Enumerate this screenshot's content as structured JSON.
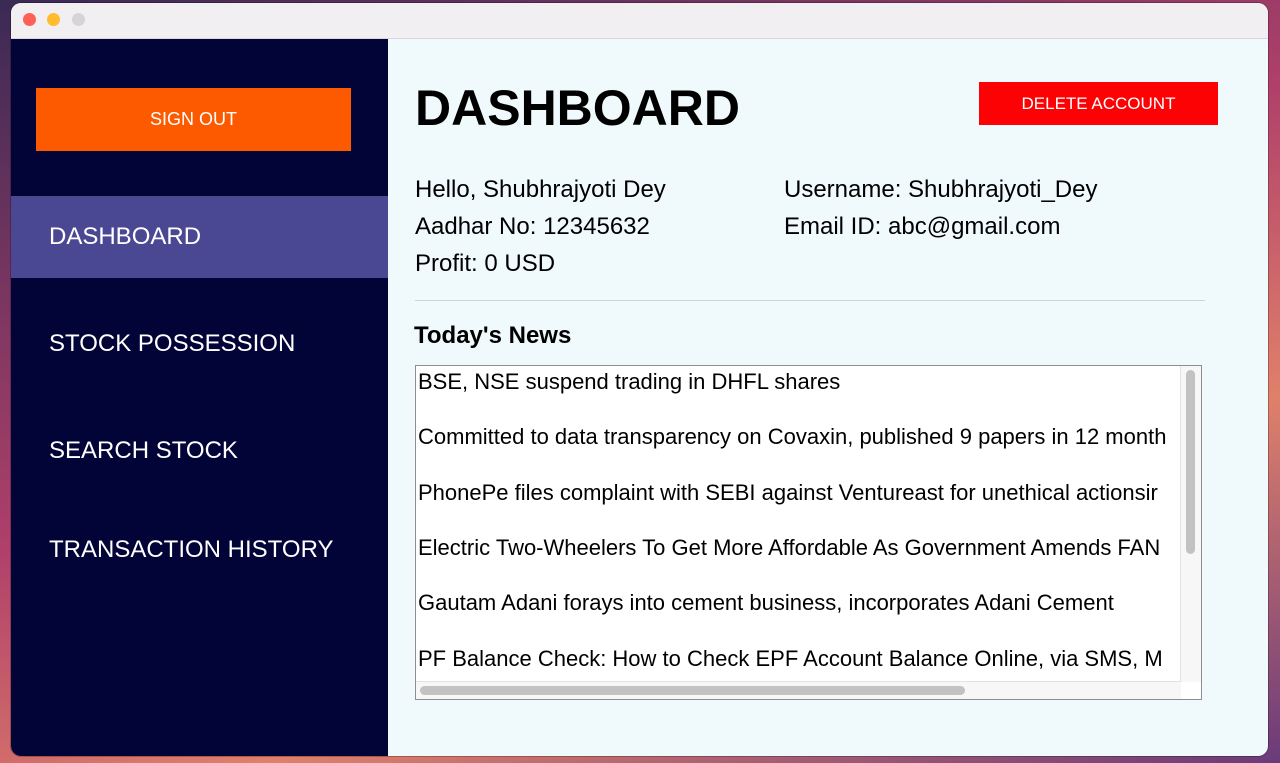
{
  "sidebar": {
    "sign_out_label": "SIGN OUT",
    "items": [
      {
        "label": "DASHBOARD",
        "active": true
      },
      {
        "label": "STOCK POSSESSION",
        "active": false
      },
      {
        "label": "SEARCH STOCK",
        "active": false
      },
      {
        "label": "TRANSACTION HISTORY",
        "active": false
      }
    ]
  },
  "header": {
    "title": "DASHBOARD",
    "delete_label": "DELETE ACCOUNT"
  },
  "user": {
    "greeting": "Hello, Shubhrajyoti Dey",
    "aadhar": "Aadhar No: 12345632",
    "profit": "Profit: 0 USD",
    "username": "Username: Shubhrajyoti_Dey",
    "email": "Email ID: abc@gmail.com"
  },
  "news": {
    "heading": "Today's News",
    "items": [
      "BSE, NSE suspend trading in DHFL shares",
      "Committed to data transparency on Covaxin, published 9 papers in 12 month",
      "PhonePe files complaint with SEBI against Ventureast for unethical actionsir",
      "Electric Two-Wheelers To Get More Affordable As Government Amends FAN",
      "Gautam Adani forays into cement business, incorporates Adani Cement",
      "PF Balance Check: How to Check EPF Account Balance Online, via SMS, M"
    ]
  },
  "colors": {
    "sidebar_bg": "#020336",
    "sidebar_active": "#4b4893",
    "sign_out": "#fd5a00",
    "delete": "#fc0204",
    "content_bg": "#f0f9fc"
  }
}
